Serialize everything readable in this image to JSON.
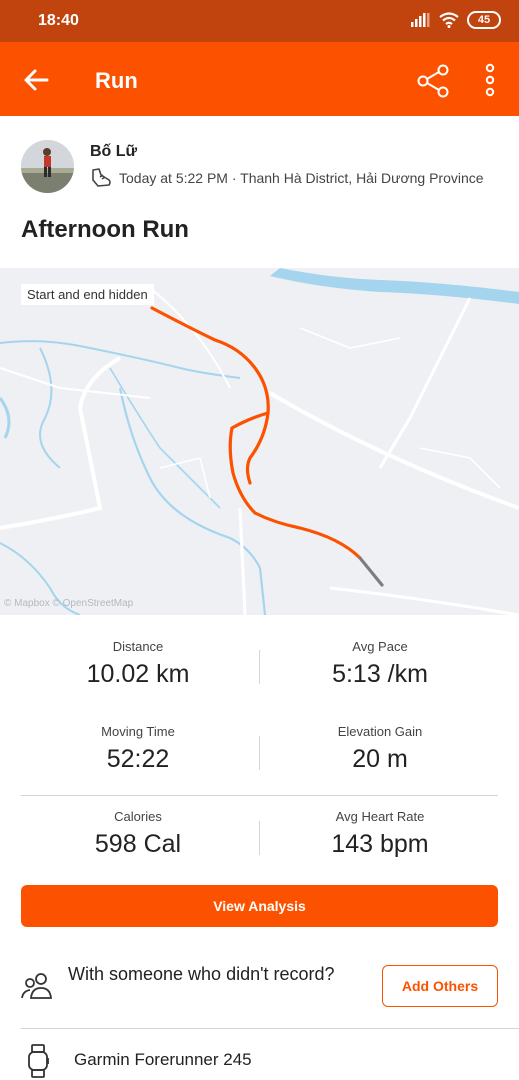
{
  "status_bar": {
    "time": "18:40",
    "battery": "45"
  },
  "app_bar": {
    "title": "Run"
  },
  "athlete": {
    "name": "Bố Lữ",
    "meta": "Today at 5:22 PM · Thanh Hà District, Hải Dương Province"
  },
  "activity": {
    "title": "Afternoon Run"
  },
  "map": {
    "privacy_label": "Start and end hidden",
    "credit": "© Mapbox © OpenStreetMap",
    "route_color": "#fc5200"
  },
  "stats": {
    "distance": {
      "label": "Distance",
      "value": "10.02 km"
    },
    "avg_pace": {
      "label": "Avg Pace",
      "value": "5:13 /km"
    },
    "moving_time": {
      "label": "Moving Time",
      "value": "52:22"
    },
    "elevation_gain": {
      "label": "Elevation Gain",
      "value": "20 m"
    },
    "calories": {
      "label": "Calories",
      "value": "598 Cal"
    },
    "avg_heart_rate": {
      "label": "Avg Heart Rate",
      "value": "143 bpm"
    }
  },
  "buttons": {
    "view_analysis": "View Analysis",
    "add_others": "Add Others"
  },
  "group": {
    "prompt": "With someone who didn't record?"
  },
  "device": {
    "name": "Garmin Forerunner 245"
  },
  "colors": {
    "brand": "#fc5200",
    "status_bar": "#c1440e"
  },
  "icons": [
    "back-arrow-icon",
    "share-icon",
    "more-vertical-icon",
    "shoe-icon",
    "people-icon",
    "watch-icon",
    "signal-icon",
    "wifi-icon",
    "battery-icon"
  ]
}
